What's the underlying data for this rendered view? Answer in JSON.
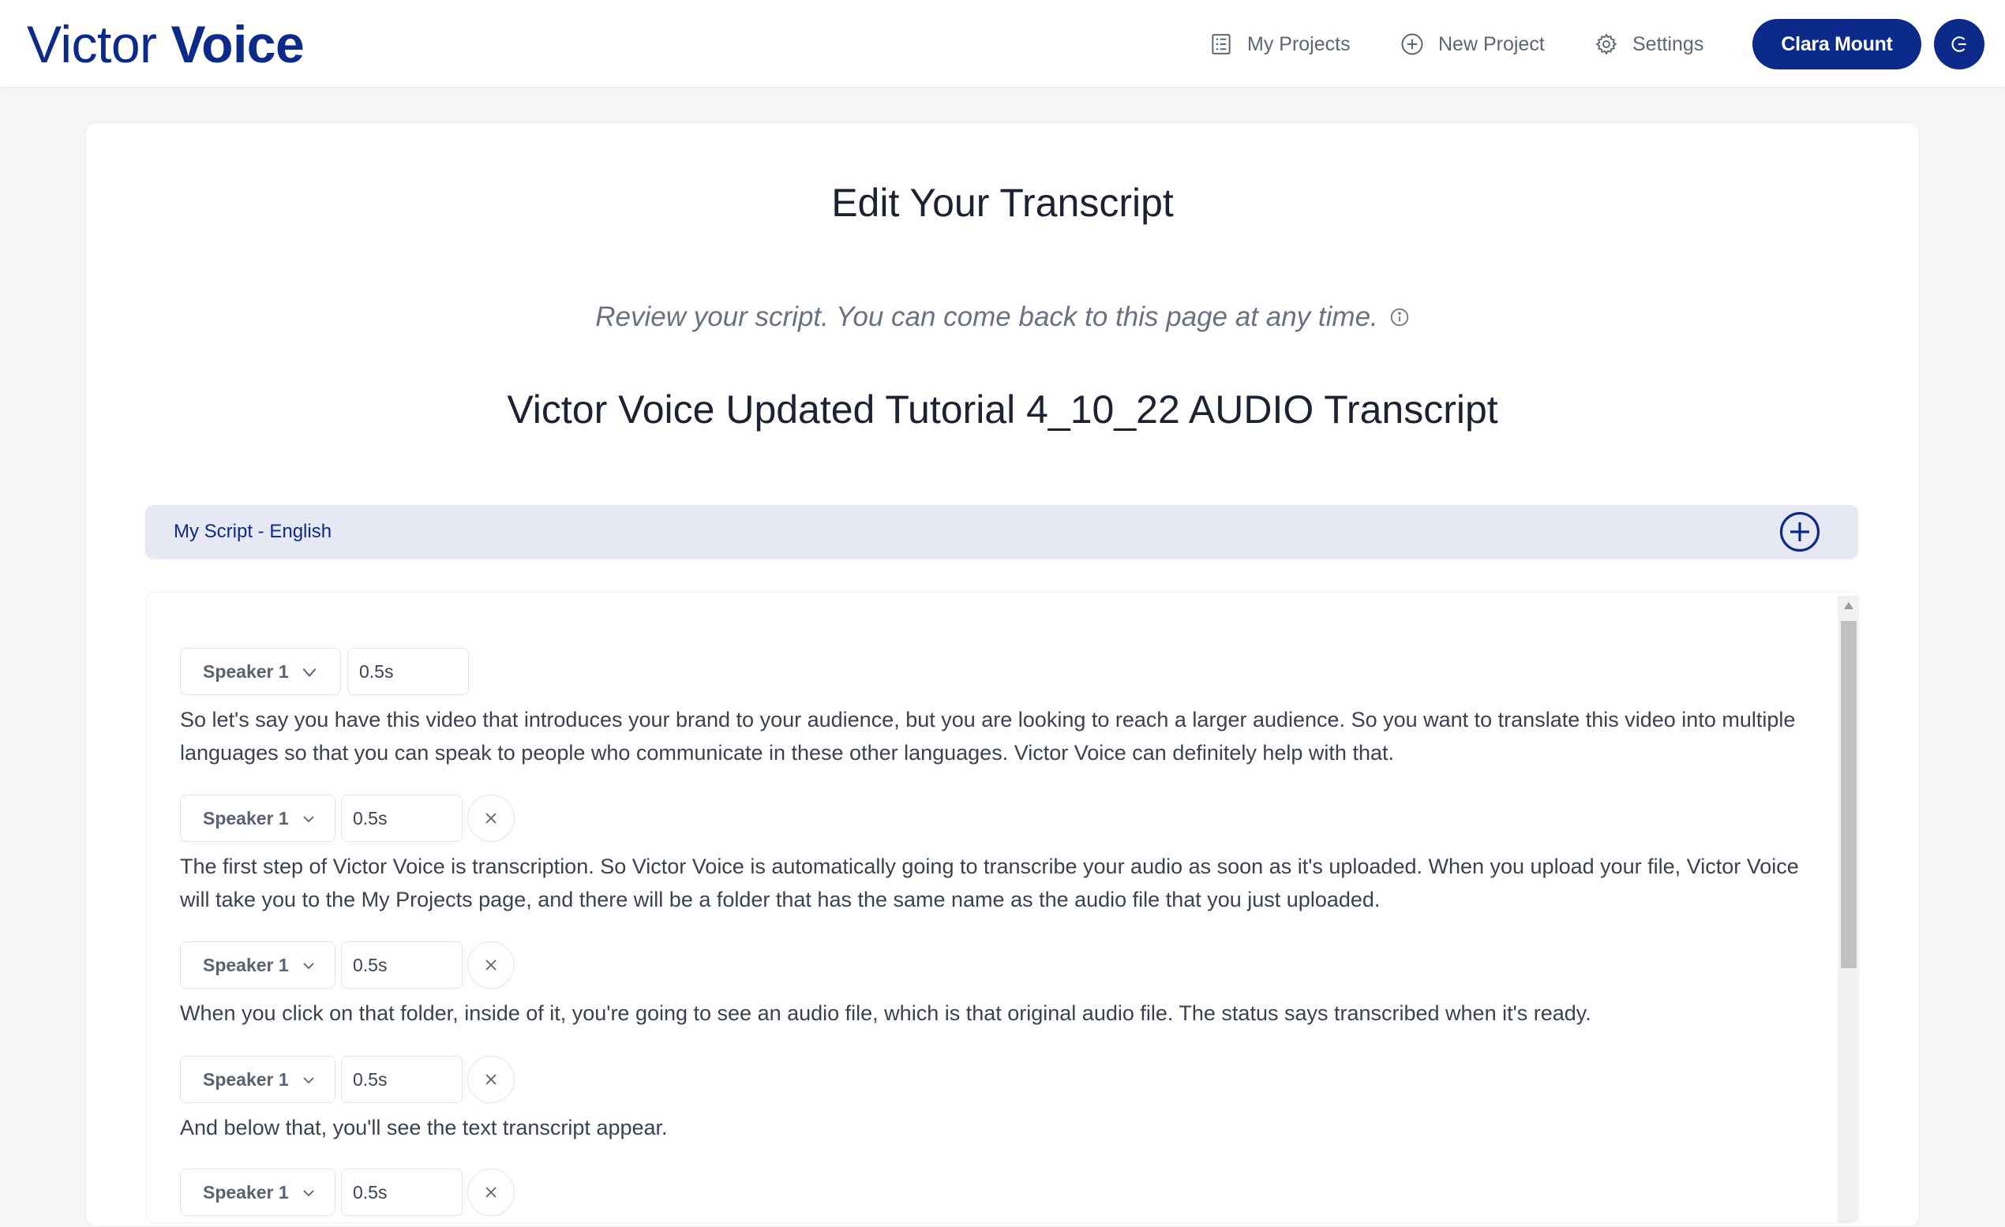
{
  "brand": {
    "name_light": "Victor",
    "name_bold": "Voice",
    "color": "#0c2a8a"
  },
  "nav": {
    "my_projects": "My Projects",
    "new_project": "New Project",
    "settings": "Settings",
    "user": "Clara Mount"
  },
  "page": {
    "title": "Edit Your Transcript",
    "subtitle": "Review your script. You can come back to this page at any time.",
    "transcript_title": "Victor Voice Updated Tutorial 4_10_22 AUDIO Transcript"
  },
  "script_bar": {
    "label": "My Script - English"
  },
  "segments": [
    {
      "speaker": "Speaker 1",
      "pause": "0.5s",
      "text": "So let's say you have this video that introduces your brand to your audience, but you are looking to reach a larger audience. So you want to translate this video into multiple languages so that you can speak to people who communicate in these other languages. Victor Voice can definitely help with that."
    },
    {
      "speaker": "Speaker 1",
      "pause": "0.5s",
      "text": "The first step of Victor Voice is transcription. So Victor Voice is automatically going to transcribe your audio as soon as it's uploaded. When you upload your file, Victor Voice will take you to the My Projects page, and there will be a folder that has the same name as the audio file that you just uploaded."
    },
    {
      "speaker": "Speaker 1",
      "pause": "0.5s",
      "text": "When you click on that folder, inside of it, you're going to see an audio file, which is that original audio file. The status says transcribed when it's ready."
    },
    {
      "speaker": "Speaker 1",
      "pause": "0.5s",
      "text": "And below that, you'll see the text transcript appear."
    },
    {
      "speaker": "Speaker 1",
      "pause": "0.5s",
      "text": ""
    }
  ]
}
